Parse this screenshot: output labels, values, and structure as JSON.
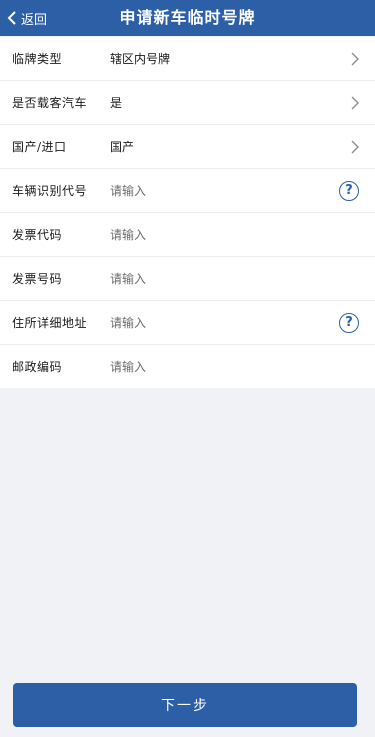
{
  "header": {
    "back_label": "返回",
    "title": "申请新车临时号牌"
  },
  "form": {
    "plate_type": {
      "label": "临牌类型",
      "value": "辖区内号牌"
    },
    "passenger_car": {
      "label": "是否载客汽车",
      "value": "是"
    },
    "origin": {
      "label": "国产/进口",
      "value": "国产"
    },
    "vin": {
      "label": "车辆识别代号",
      "placeholder": "请输入"
    },
    "invoice_code": {
      "label": "发票代码",
      "placeholder": "请输入"
    },
    "invoice_number": {
      "label": "发票号码",
      "placeholder": "请输入"
    },
    "address": {
      "label": "住所详细地址",
      "placeholder": "请输入"
    },
    "postal_code": {
      "label": "邮政编码",
      "placeholder": "请输入"
    }
  },
  "help_icon_glyph": "?",
  "footer": {
    "next_label": "下一步"
  },
  "colors": {
    "primary": "#2c5fa6",
    "background": "#f1f2f6"
  }
}
